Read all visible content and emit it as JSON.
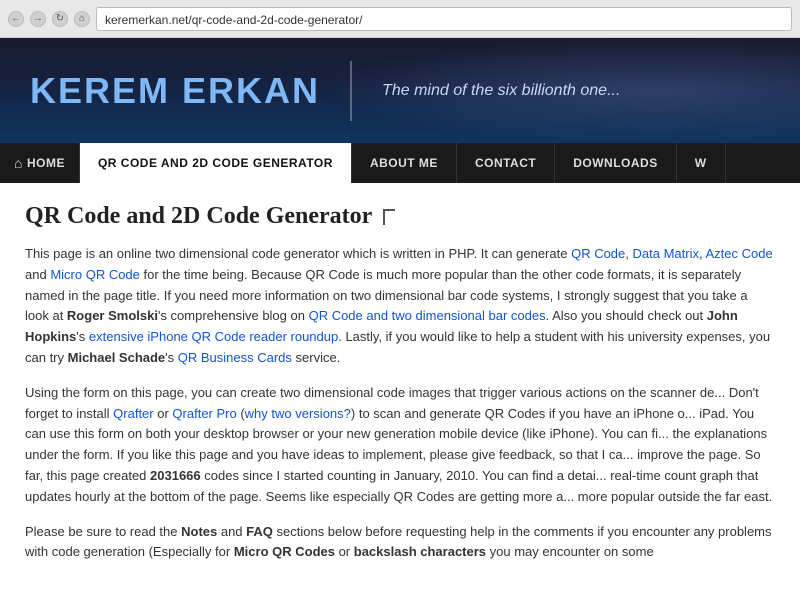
{
  "browser": {
    "url": "keremerkan.net/qr-code-and-2d-code-generator/"
  },
  "header": {
    "logo_part1": "KEREM",
    "logo_part2": "ERKAN",
    "tagline": "The mind of the six billionth one..."
  },
  "nav": {
    "items": [
      {
        "label": "HOME",
        "id": "home",
        "active": false
      },
      {
        "label": "QR CODE AND 2D CODE GENERATOR",
        "id": "qr-code",
        "active": true
      },
      {
        "label": "ABOUT ME",
        "id": "about",
        "active": false
      },
      {
        "label": "CONTACT",
        "id": "contact",
        "active": false
      },
      {
        "label": "DOWNLOADS",
        "id": "downloads",
        "active": false
      },
      {
        "label": "W",
        "id": "more",
        "active": false
      }
    ]
  },
  "main": {
    "title": "QR Code and 2D Code Generator",
    "paragraphs": [
      "This page is an online two dimensional code generator which is written in PHP. It can generate QR Code, Data Matrix, Aztec Code and Micro QR Code for the time being. Because QR Code is much more popular than the other code formats, it is separately named in the page title. If you need more information on two dimensional bar code systems, I strongly suggest that you take a look at Roger Smolski's comprehensive blog on QR Code and two dimensional bar codes. Also you should check out John Hopkins's extensive iPhone QR Code reader roundup. Lastly, if you would like to help a student with his university expenses, you can try Michael Schade's QR Business Cards service.",
      "Using the form on this page, you can create two dimensional code images that trigger various actions on the scanner device. Don't forget to install Qrafter or Qrafter Pro (why two versions?) to scan and generate QR Codes if you have an iPhone or iPad. You can use this form on both your desktop browser or your new generation mobile device (like iPhone). You can find the explanations under the form. If you like this page and you have ideas to implement, please give feedback, so that I can improve the page. So far, this page created 2031666 codes since I started counting in January, 2010. You can find a detailed real-time count graph that updates hourly at the bottom of the page. Seems like especially QR Codes are getting more and more popular outside the far east.",
      "Please be sure to read the Notes and FAQ sections below before requesting help in the comments if you encounter any problems with code generation (Especially for Micro QR Codes or backslash characters you may encounter on some"
    ],
    "links": {
      "qr_code": "QR Code",
      "data_matrix": "Data Matrix",
      "aztec_code": "Aztec Code",
      "micro_qr": "Micro QR Code",
      "smolski_blog": "QR Code and two dimensional bar codes",
      "hopkins": "extensive iPhone QR Code reader roundup",
      "schade": "QR Business Cards",
      "qrafter": "Qrafter",
      "qrafter_pro": "Qrafter Pro",
      "why_versions": "why two versions?"
    }
  }
}
